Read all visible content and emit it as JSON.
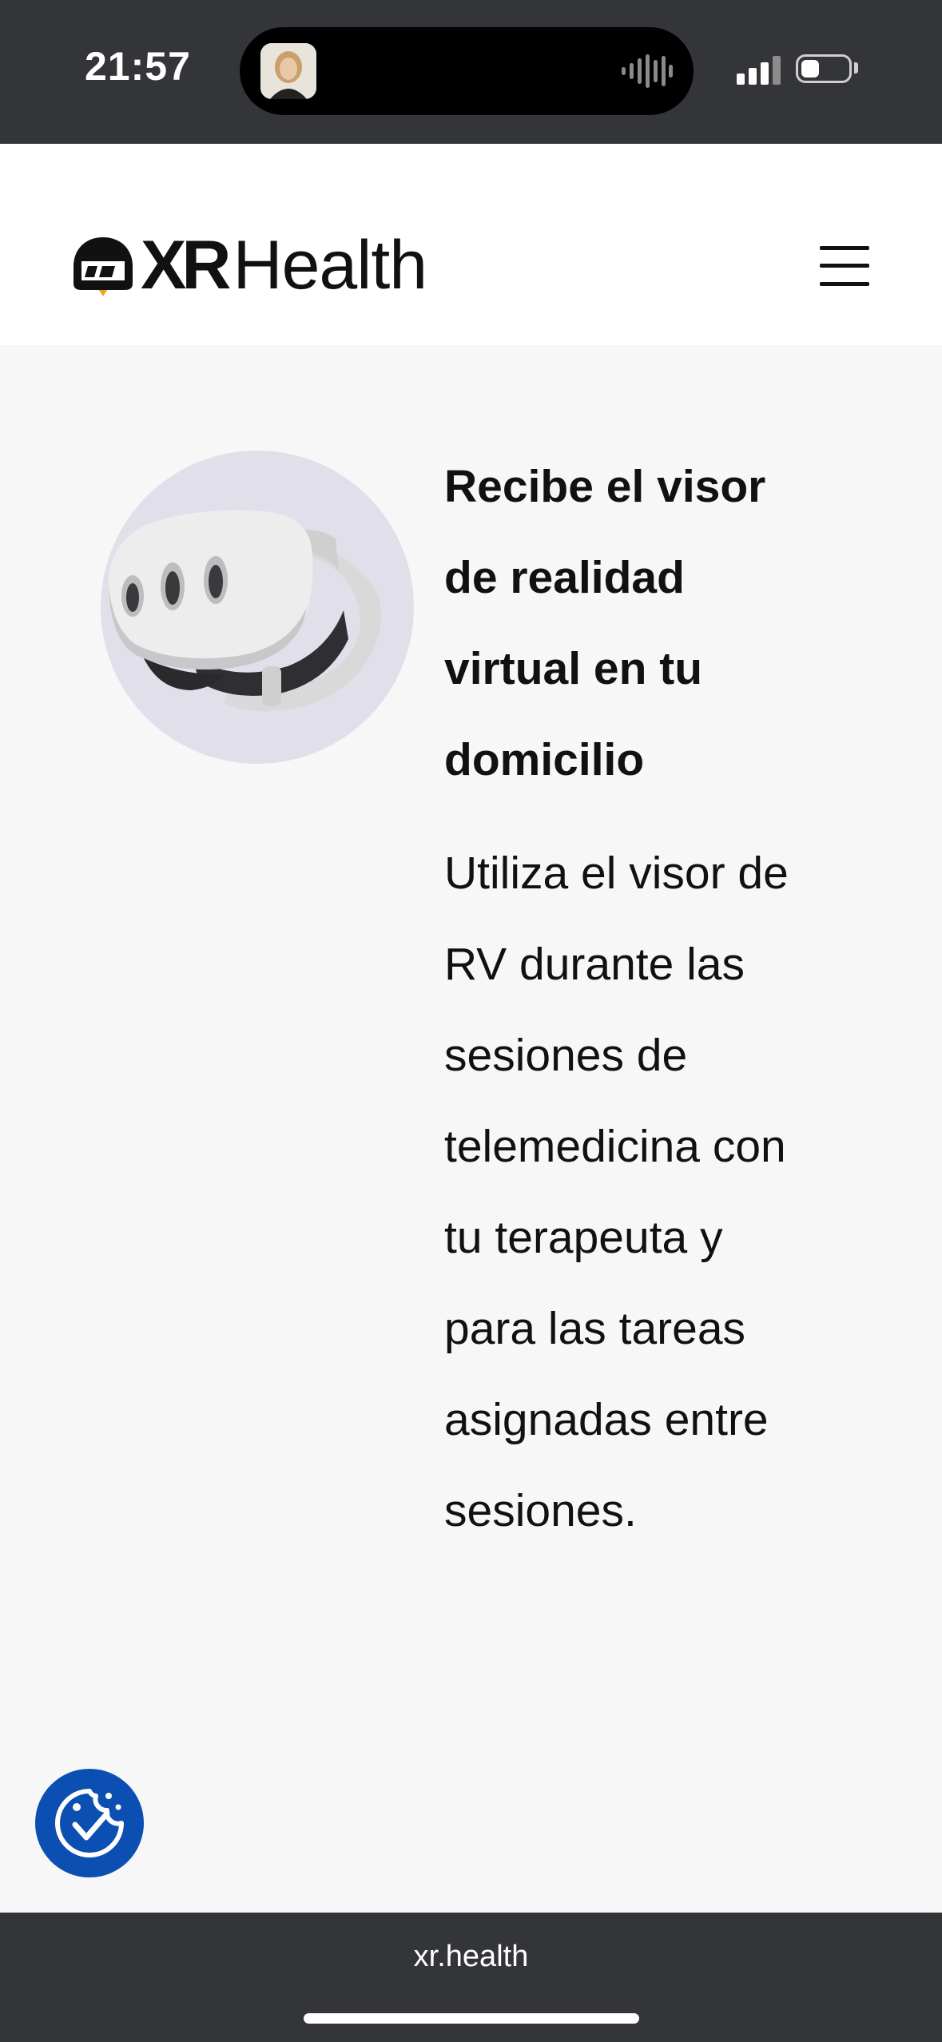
{
  "status_bar": {
    "time": "21:57",
    "signal_icon": "cellular-signal-icon",
    "battery_icon": "battery-icon",
    "island_icon": "audio-waveform-icon"
  },
  "header": {
    "logo_bold": "XR",
    "logo_regular": "Health",
    "menu_icon": "hamburger-menu-icon"
  },
  "main": {
    "image_alt": "vr-headset-image",
    "headline": "Recibe el visor de realidad virtual en tu domicilio",
    "body": "Utiliza el visor de RV durante las sesiones de telemedicina con tu terapeuta y para las tareas asignadas entre sesiones."
  },
  "consent": {
    "icon": "cookie-check-icon",
    "color": "#0b4fb3"
  },
  "browser": {
    "url": "xr.health"
  },
  "colors": {
    "system_bar": "#343538",
    "page_bg": "#f7f7f7",
    "header_bg": "#ffffff",
    "text": "#111111"
  }
}
